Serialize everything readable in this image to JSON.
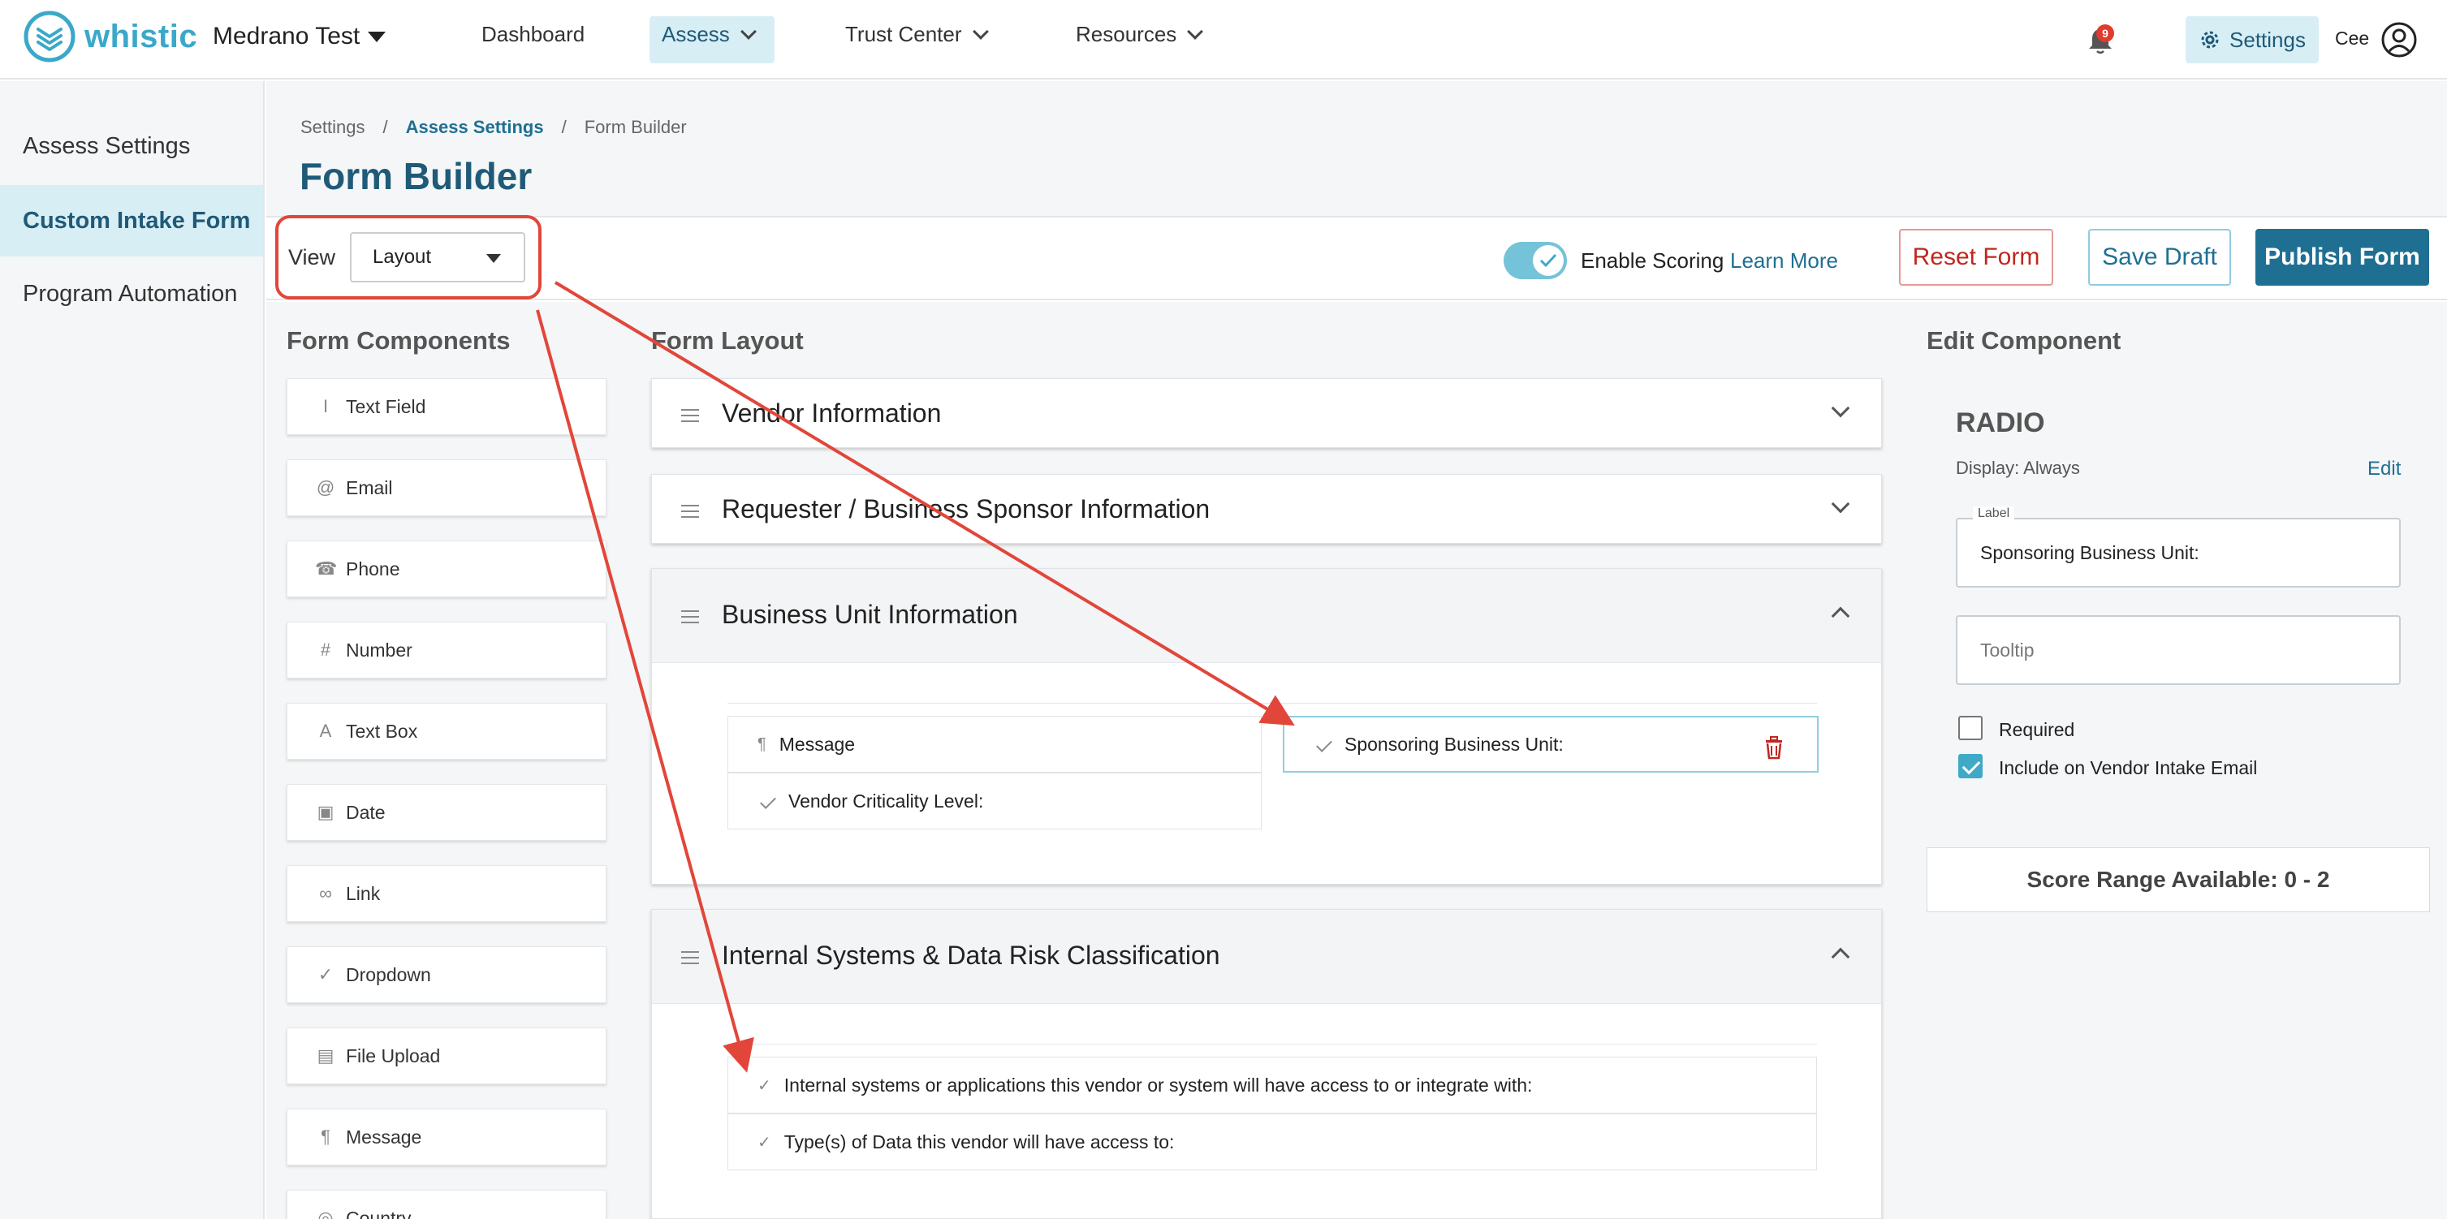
{
  "brand": {
    "name": "whistic",
    "color": "#3aa8c9"
  },
  "account": {
    "name": "Medrano Test"
  },
  "nav": {
    "dashboard": "Dashboard",
    "assess": "Assess",
    "trust_center": "Trust Center",
    "resources": "Resources",
    "notifications_count": "9",
    "settings": "Settings",
    "user": "Cee"
  },
  "sidebar": {
    "items": [
      {
        "label": "Assess Settings"
      },
      {
        "label": "Custom Intake Form"
      },
      {
        "label": "Program Automation"
      }
    ]
  },
  "breadcrumb": [
    "Settings",
    "/",
    "Assess Settings",
    "/",
    "Form Builder"
  ],
  "page_title": "Form Builder",
  "toolbar": {
    "view_label": "View",
    "view_value": "Layout",
    "enable_scoring": "Enable Scoring",
    "learn_more": "Learn More",
    "reset": "Reset Form",
    "save_draft": "Save Draft",
    "publish": "Publish Form"
  },
  "components": {
    "title": "Form Components",
    "items": [
      {
        "label": "Text Field",
        "icon": "text-cursor-icon"
      },
      {
        "label": "Email",
        "icon": "at-icon"
      },
      {
        "label": "Phone",
        "icon": "phone-icon"
      },
      {
        "label": "Number",
        "icon": "hash-icon"
      },
      {
        "label": "Text Box",
        "icon": "letter-a-icon"
      },
      {
        "label": "Date",
        "icon": "calendar-icon"
      },
      {
        "label": "Link",
        "icon": "link-icon"
      },
      {
        "label": "Dropdown",
        "icon": "check-icon"
      },
      {
        "label": "File Upload",
        "icon": "file-icon"
      },
      {
        "label": "Message",
        "icon": "pilcrow-icon"
      },
      {
        "label": "Country",
        "icon": "globe-icon"
      }
    ]
  },
  "layout": {
    "title": "Form Layout",
    "sections": [
      {
        "title": "Vendor Information"
      },
      {
        "title": "Requester / Business Sponsor Information"
      },
      {
        "title": "Business Unit Information",
        "fields_left": [
          "Message",
          "Vendor Criticality Level:"
        ],
        "fields_right": [
          "Sponsoring Business Unit:"
        ]
      },
      {
        "title": "Internal Systems & Data Risk Classification",
        "fields": [
          "Internal systems or applications this vendor or system will have access to or integrate with:",
          "Type(s) of Data this vendor will have access to:"
        ]
      }
    ]
  },
  "edit": {
    "title": "Edit Component",
    "type": "RADIO",
    "display": "Display: Always",
    "edit_link": "Edit",
    "label_legend": "Label",
    "label_value": "Sponsoring Business Unit:",
    "tooltip_placeholder": "Tooltip",
    "required": "Required",
    "include_email": "Include on Vendor Intake Email",
    "score_range": "Score Range Available: 0 - 2"
  }
}
